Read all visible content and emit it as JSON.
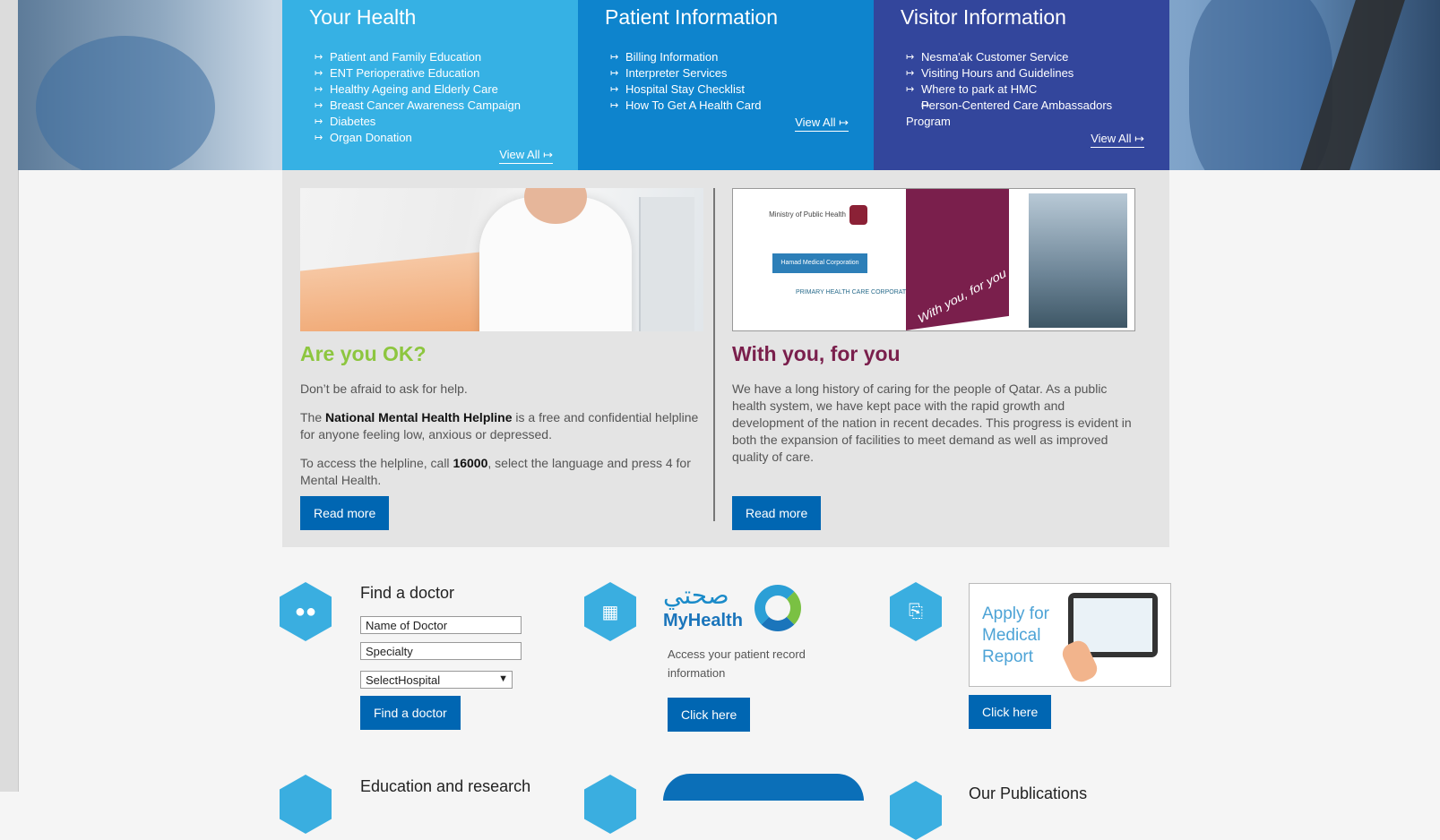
{
  "panels": {
    "your_health": {
      "title": "Your Health",
      "items": [
        "Patient and Family Education",
        "ENT Perioperative Education",
        "Healthy Ageing and Elderly Care",
        "Breast Cancer Awareness Campaign",
        "Diabetes",
        "Organ Donation"
      ],
      "view_all": "View All ↦"
    },
    "patient_info": {
      "title": "Patient Information",
      "items": [
        "Billing Information",
        "Interpreter Services",
        "Hospital Stay Checklist",
        "How To Get A Health Card"
      ],
      "view_all": "View All ↦"
    },
    "visitor_info": {
      "title": "Visitor Information",
      "items": [
        "Nesma'ak Customer Service",
        "Visiting Hours and Guidelines",
        "Where to park at HMC",
        "Person-Centered Care Ambassadors Program"
      ],
      "view_all": "View All ↦"
    }
  },
  "feature_left": {
    "heading": "Are you OK?",
    "p1": "Don’t be afraid to ask for help.",
    "p2_pre": "The ",
    "p2_bold": "National Mental Health Helpline",
    "p2_post": " is a free and confidential helpline for anyone feeling low, anxious or depressed.",
    "p3_pre": "To access the helpline, call ",
    "p3_bold": "16000",
    "p3_post": ", select the language and press 4 for Mental Health.",
    "button": "Read more"
  },
  "feature_right": {
    "heading": "With you, for you",
    "body": "We have a long history of caring for the people of Qatar. As a public health system, we have kept pace with the rapid growth and development of the nation in recent decades. This progress is evident in both the expansion of facilities to meet demand as well as improved quality of care.",
    "button": "Read more",
    "image_text": {
      "mop": "Ministry of Public Health",
      "hmc": "Hamad Medical Corporation",
      "phc": "PRIMARY HEALTH CARE CORPORATION",
      "slogan": "With you, for you"
    }
  },
  "find_doctor": {
    "title": "Find a doctor",
    "name_placeholder": "Name of Doctor",
    "specialty_placeholder": "Specialty",
    "hospital_select": "SelectHospital",
    "button": "Find a doctor"
  },
  "myhealth": {
    "arabic": "صحتي",
    "english": "MyHealth",
    "desc": "Access your patient record information",
    "button": "Click here"
  },
  "medical_report": {
    "text": "Apply for Medical Report",
    "button": "Click here"
  },
  "bottom": {
    "education": "Education and research",
    "publications": "Our Publications"
  },
  "colors": {
    "your_health": "#36b1e4",
    "patient_info": "#0e84cd",
    "visitor_info": "#33469c",
    "button_blue": "#0066b2",
    "green_heading": "#8dc63f",
    "maroon_heading": "#7a1f4c",
    "hex_icon": "#3aaee0"
  },
  "icons": [
    "people-icon",
    "monitor-icon",
    "clipboard-icon",
    "arrow-right-icon",
    "chevron-down-icon"
  ]
}
